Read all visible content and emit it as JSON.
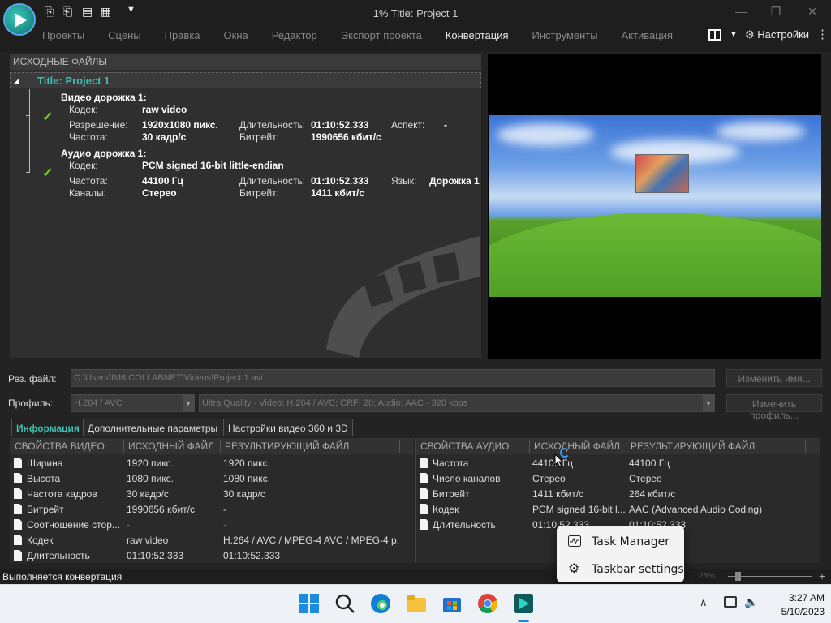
{
  "window": {
    "title": "1% Title: Project 1",
    "menu": [
      "Проекты",
      "Сцены",
      "Правка",
      "Окна",
      "Редактор",
      "Экспорт проекта",
      "Конвертация",
      "Инструменты",
      "Активация"
    ],
    "settings_label": "Настройки"
  },
  "source": {
    "header": "ИСХОДНЫЕ ФАЙЛЫ",
    "root": "Title: Project 1",
    "video": {
      "title": "Видео дорожка 1:",
      "codec_label": "Кодек:",
      "codec": "raw video",
      "res_label": "Разрешение:",
      "res": "1920x1080 пикс.",
      "dur_label": "Длительность:",
      "dur": "01:10:52.333",
      "aspect_label": "Аспект:",
      "aspect": "-",
      "fps_label": "Частота:",
      "fps": "30 кадр/с",
      "bitrate_label": "Битрейт:",
      "bitrate": "1990656 кбит/с"
    },
    "audio": {
      "title": "Аудио дорожка 1:",
      "codec_label": "Кодек:",
      "codec": "PCM signed 16-bit little-endian",
      "freq_label": "Частота:",
      "freq": "44100 Гц",
      "dur_label": "Длительность:",
      "dur": "01:10:52.333",
      "lang_label": "Язык:",
      "lang": "Дорожка 1",
      "channels_label": "Каналы:",
      "channels": "Стерео",
      "bitrate_label": "Битрейт:",
      "bitrate": "1411 кбит/с"
    }
  },
  "output": {
    "file_label": "Рез. файл:",
    "file_path": "C:\\Users\\IM6.COLLABNET\\Videos\\Project 1.avi",
    "rename_button": "Изменить имя...",
    "profile_label": "Профиль:",
    "profile_format": "H.264 / AVC",
    "profile_quality": "Ultra Quality - Video: H.264 / AVC; CRF: 20; Audio: AAC - 320 kbps",
    "profile_button": "Изменить профиль..."
  },
  "tabs": [
    "Информация",
    "Дополнительные параметры",
    "Настройки видео 360 и 3D"
  ],
  "video_table": {
    "headers": [
      "СВОЙСТВА ВИДЕО",
      "ИСХОДНЫЙ ФАЙЛ",
      "РЕЗУЛЬТИРУЮЩИЙ ФАЙЛ"
    ],
    "rows": [
      [
        "Ширина",
        "1920 пикс.",
        "1920 пикс."
      ],
      [
        "Высота",
        "1080 пикс.",
        "1080 пикс."
      ],
      [
        "Частота кадров",
        "30 кадр/с",
        "30 кадр/с"
      ],
      [
        "Битрейт",
        "1990656 кбит/с",
        "-"
      ],
      [
        "Соотношение стор...",
        "-",
        "-"
      ],
      [
        "Кодек",
        "raw video",
        "H.264 / AVC / MPEG-4 AVC / MPEG-4 p..."
      ],
      [
        "Длительность",
        "01:10:52.333",
        "01:10:52.333"
      ]
    ]
  },
  "audio_table": {
    "headers": [
      "СВОЙСТВА АУДИО",
      "ИСХОДНЫЙ ФАЙЛ",
      "РЕЗУЛЬТИРУЮЩИЙ ФАЙЛ"
    ],
    "rows": [
      [
        "Частота",
        "44100 Гц",
        "44100 Гц"
      ],
      [
        "Число каналов",
        "Стерео",
        "Стерео"
      ],
      [
        "Битрейт",
        "1411 кбит/с",
        "264 кбит/с"
      ],
      [
        "Кодек",
        "PCM signed 16-bit l...",
        "AAC (Advanced Audio Coding)"
      ],
      [
        "Длительность",
        "01:10:52.333",
        "01:10:52.333"
      ]
    ]
  },
  "status": {
    "text": "Выполняется конвертация",
    "zoom": "25%"
  },
  "context_menu": {
    "items": [
      "Task Manager",
      "Taskbar settings"
    ]
  },
  "taskbar": {
    "time": "3:27 AM",
    "date": "5/10/2023"
  }
}
